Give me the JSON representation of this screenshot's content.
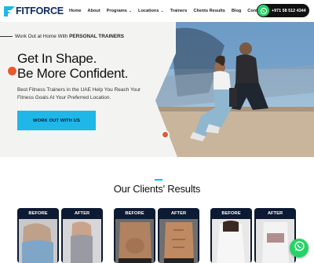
{
  "brand": {
    "fit": "FIT",
    "force": "FORCE",
    "logo_icon": "fitforce-logo-icon"
  },
  "nav": {
    "items": [
      {
        "label": "Home",
        "dropdown": false
      },
      {
        "label": "About",
        "dropdown": false
      },
      {
        "label": "Programs",
        "dropdown": true
      },
      {
        "label": "Locations",
        "dropdown": true
      },
      {
        "label": "Trainers",
        "dropdown": false
      },
      {
        "label": "Clients Results",
        "dropdown": false
      },
      {
        "label": "Blog",
        "dropdown": false
      },
      {
        "label": "Contact",
        "dropdown": false
      }
    ],
    "caret": "⌄",
    "whatsapp_phone": "+971 58 512 4344"
  },
  "hero": {
    "subtitle_prefix": "Work Out at Home With",
    "subtitle_bold": "PERSONAL TRAINERS",
    "headline_line1": "Get In Shape.",
    "headline_line2": "Be More Confident.",
    "description": "Best Fitness Trainers in the UAE Help You Reach Your Fitness Goals At Your Preferred Location.",
    "cta_label": "WORK OUT WITH US"
  },
  "results": {
    "title": "Our Clients' Results",
    "cards": [
      {
        "label": "BEFORE"
      },
      {
        "label": "AFTER"
      },
      {
        "label": "BEFORE"
      },
      {
        "label": "AFTER"
      },
      {
        "label": "BEFORE"
      },
      {
        "label": "AFTER"
      }
    ]
  },
  "colors": {
    "accent": "#1fb7e8",
    "navy": "#0d1a33",
    "whatsapp": "#25d366",
    "orange": "#e85a2b"
  }
}
